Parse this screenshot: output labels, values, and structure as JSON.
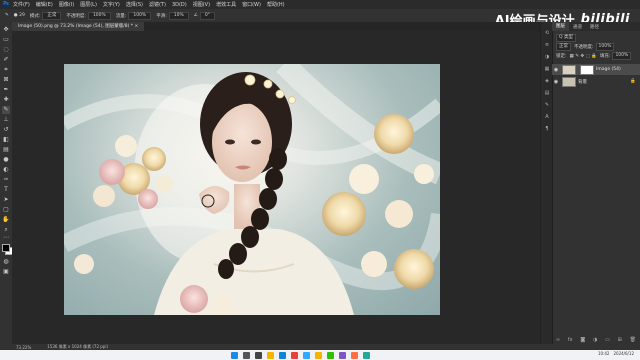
{
  "app": {
    "logo": "Ps"
  },
  "menu": [
    "文件(F)",
    "编辑(E)",
    "图像(I)",
    "图层(L)",
    "文字(Y)",
    "选择(S)",
    "滤镜(T)",
    "3D(D)",
    "视图(V)",
    "增效工具",
    "窗口(W)",
    "帮助(H)"
  ],
  "options": {
    "size": "29",
    "mode_label": "模式:",
    "mode_value": "正常",
    "opacity_label": "不透明度:",
    "opacity_value": "100%",
    "flow_label": "流量:",
    "flow_value": "100%",
    "smooth_label": "平滑:",
    "smooth_value": "10%",
    "angle_value": "0°"
  },
  "brand": {
    "title": "AI绘画与设计",
    "bili": "bilibili"
  },
  "document_tab": "Image (50).png @ 73.2% (Image (54), 图层蒙版/8) *",
  "toolbar": {
    "icons": [
      "move-icon",
      "marquee-icon",
      "lasso-icon",
      "quick-select-icon",
      "crop-icon",
      "frame-icon",
      "eyedropper-icon",
      "healing-icon",
      "brush-icon",
      "stamp-icon",
      "history-brush-icon",
      "eraser-icon",
      "gradient-icon",
      "blur-icon",
      "dodge-icon",
      "pen-icon",
      "type-icon",
      "path-select-icon",
      "shape-icon",
      "hand-icon",
      "zoom-icon",
      "more-icon"
    ]
  },
  "status": {
    "zoom": "73.22%",
    "info": "1536 像素 x 1024 像素 (72 ppi)"
  },
  "panel": {
    "tabs": [
      "图层",
      "通道",
      "路径"
    ],
    "search_label": "Q 类型",
    "blend": "正常",
    "opacity_label": "不透明度:",
    "opacity_value": "100%",
    "lock_label": "锁定:",
    "fill_label": "填充:",
    "fill_value": "100%",
    "layers": [
      {
        "name": "Image (54)",
        "visible": true,
        "selected": true
      },
      {
        "name": "背景",
        "visible": true,
        "selected": false
      }
    ]
  },
  "taskbar": {
    "icons": [
      "windows-icon",
      "search-icon",
      "taskview-icon",
      "explorer-icon",
      "edge-icon",
      "chrome-icon",
      "photoshop-icon",
      "folder-icon",
      "wechat-icon",
      "app-icon",
      "app-icon",
      "app-icon"
    ],
    "colors": [
      "#1e88e5",
      "#555",
      "#444",
      "#f4b400",
      "#0a84d6",
      "#e94235",
      "#31a8ff",
      "#f4b400",
      "#2dc100",
      "#7e57c2",
      "#ff7043",
      "#26a69a"
    ]
  },
  "tray": {
    "time": "10:42",
    "date": "2024/6/12"
  },
  "colors": {
    "accent": "#31a8ff",
    "selected_layer": "#4b4b4b",
    "taskbar": "#f0f2f5"
  }
}
